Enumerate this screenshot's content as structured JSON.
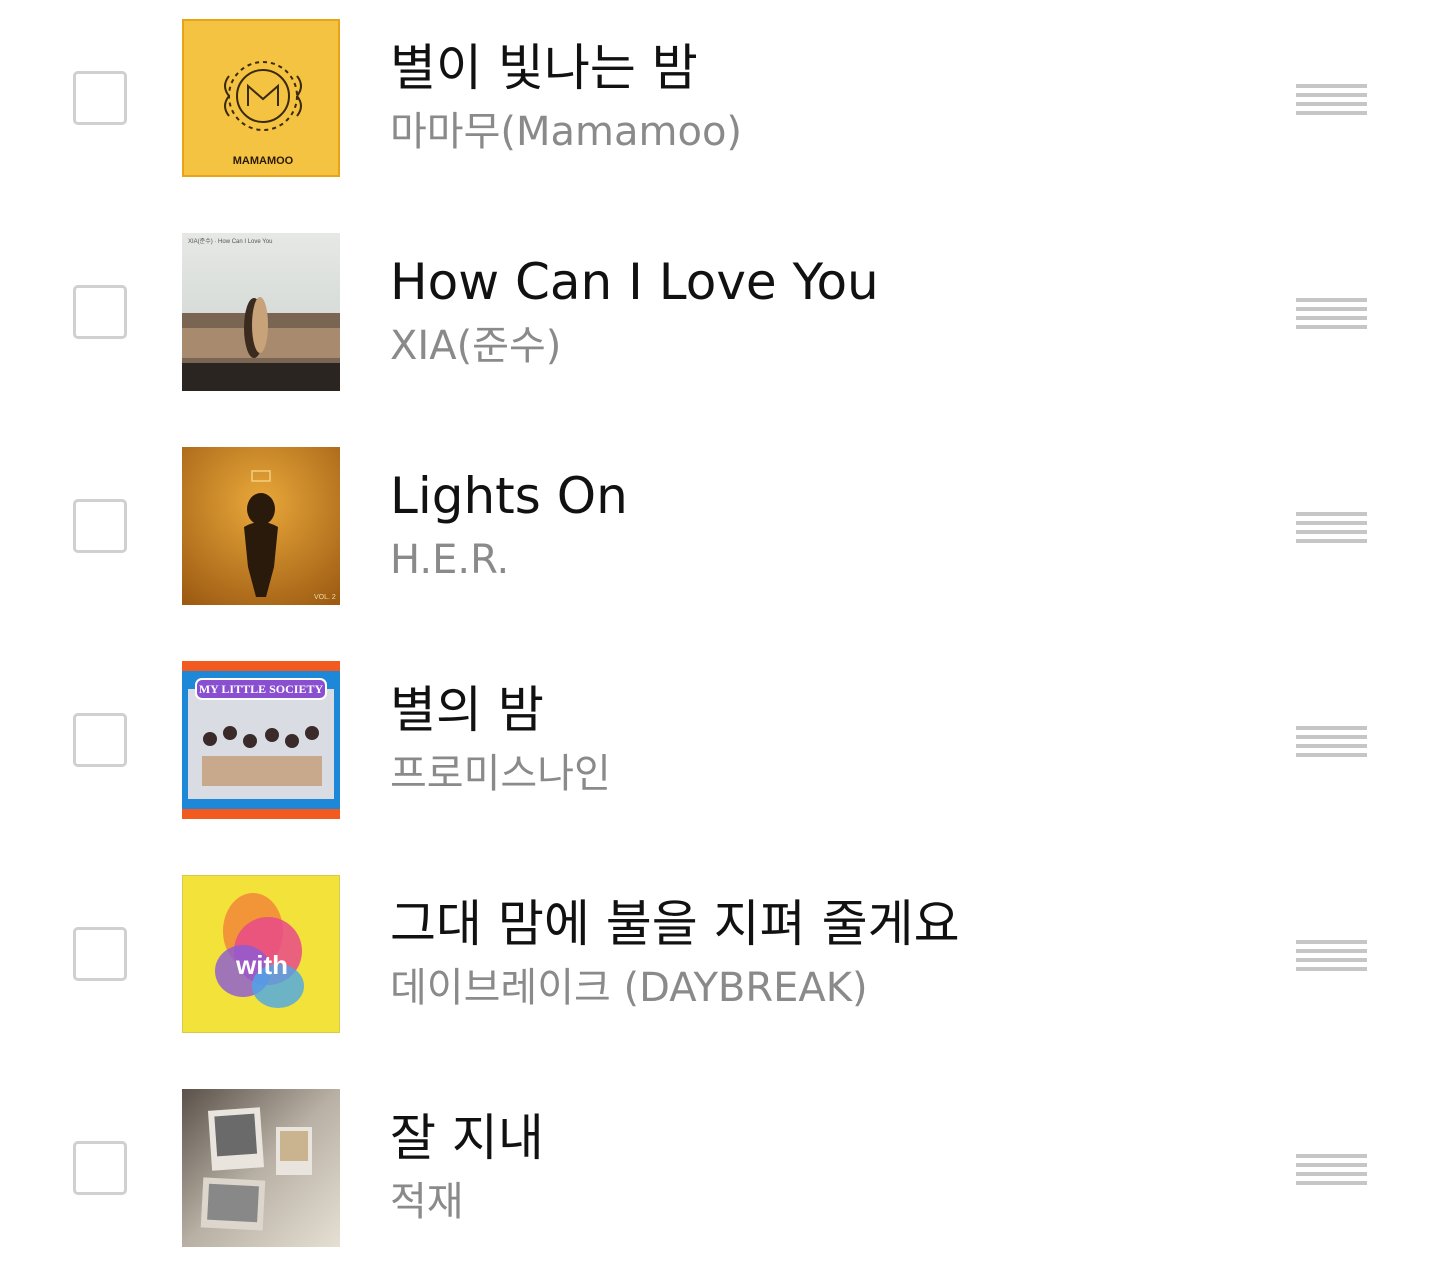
{
  "playlist": {
    "items": [
      {
        "title": "별이 빛나는 밤",
        "artist": "마마무(Mamamoo)",
        "cover": {
          "label": "MAMAMOO",
          "colors": {
            "bg": "#F5C342",
            "frame": "#E8A317"
          }
        }
      },
      {
        "title": "How Can I Love You",
        "artist": "XIA(준수)",
        "cover": {
          "label": "XIA(준수) · How Can I Love You",
          "colors": {
            "sky": "#C9D1CF",
            "ground": "#6D5A4A"
          }
        }
      },
      {
        "title": "Lights On",
        "artist": "H.E.R.",
        "cover": {
          "label": "VOL. 2",
          "colors": {
            "bg": "#C98420",
            "figure": "#2A1A0C"
          }
        }
      },
      {
        "title": "별의 밤",
        "artist": "프로미스나인",
        "cover": {
          "label": "MY LITTLE SOCIETY",
          "colors": {
            "bg": "#1E88D8",
            "band": "#F25A1F",
            "banner": "#8A4FD0"
          }
        }
      },
      {
        "title": "그대 맘에 불을 지펴 줄게요",
        "artist": "데이브레이크 (DAYBREAK)",
        "cover": {
          "label": "with",
          "colors": {
            "bg": "#F2E23A",
            "smoke": "#E84A8A"
          }
        }
      },
      {
        "title": "잘 지내",
        "artist": "적재",
        "cover": {
          "label": "",
          "colors": {
            "bg": "#9C948A",
            "photo": "#E9E5DE"
          }
        }
      }
    ]
  }
}
